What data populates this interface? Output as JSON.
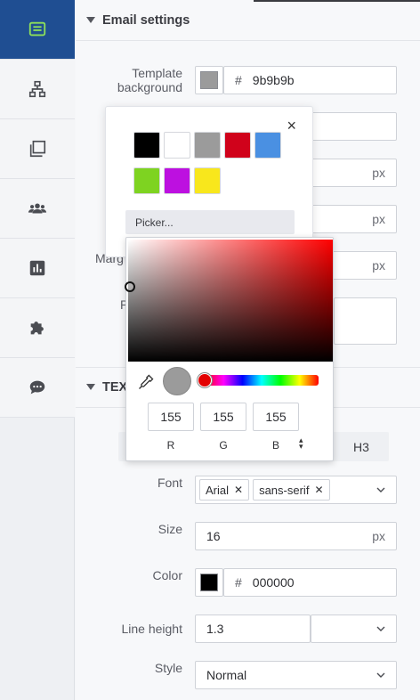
{
  "sidebar": {
    "items": [
      {
        "icon": "template-icon",
        "active": true
      },
      {
        "icon": "sitemap-icon",
        "active": false
      },
      {
        "icon": "copy-icon",
        "active": false
      },
      {
        "icon": "users-icon",
        "active": false
      },
      {
        "icon": "report-icon",
        "active": false
      },
      {
        "icon": "puzzle-icon",
        "active": false
      },
      {
        "icon": "chat-icon",
        "active": false
      }
    ]
  },
  "email_settings": {
    "title": "Email settings",
    "template_background": {
      "label_line1": "Template",
      "label_line2": "background",
      "hash": "#",
      "value": "9b9b9b",
      "color": "#9b9b9b"
    },
    "px_unit": "px",
    "hidden_label_fragments": {
      "margin": "Marg",
      "p": "P"
    }
  },
  "color_popup": {
    "close": "×",
    "palette": [
      "#000000",
      "#ffffff",
      "#9b9b9b",
      "#d0021b",
      "#4a90e2",
      "#7ed321",
      "#bd10e0",
      "#f8e71c"
    ],
    "picker_label": "Picker...",
    "rgb": {
      "r": "155",
      "g": "155",
      "b": "155",
      "r_label": "R",
      "g_label": "G",
      "b_label": "B"
    },
    "preview_color": "#9b9b9b"
  },
  "text_section": {
    "title": "TEX",
    "tab_h3": "H3",
    "font": {
      "label": "Font",
      "tags": [
        "Arial",
        "sans-serif"
      ]
    },
    "size": {
      "label": "Size",
      "value": "16",
      "unit": "px"
    },
    "color": {
      "label": "Color",
      "hash": "#",
      "value": "000000",
      "color": "#000000"
    },
    "line_height": {
      "label": "Line height",
      "value": "1.3",
      "unit_select": ""
    },
    "style": {
      "label": "Style",
      "value": "Normal"
    }
  }
}
